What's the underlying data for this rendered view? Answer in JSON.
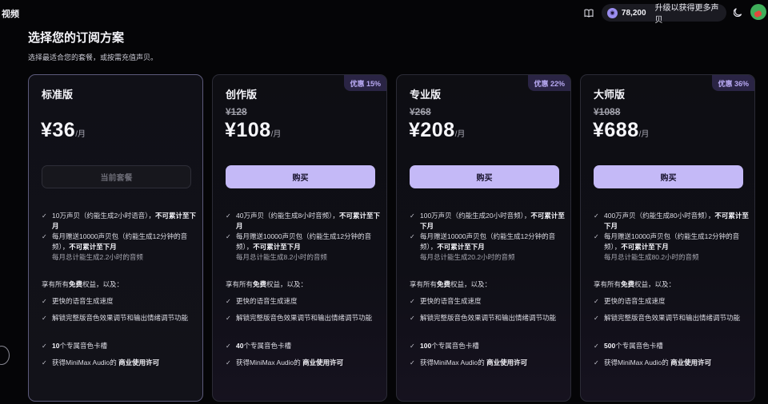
{
  "top": {
    "left_tab": "视频",
    "credits": "78,200",
    "upgrade": "升级以获得更多声贝"
  },
  "header": {
    "title": "选择您的订阅方案",
    "subtitle": "选择最适合您的套餐，或按需充值声贝。"
  },
  "common": {
    "per_month": "/月",
    "included_prefix": "享有所有",
    "included_bold": "免费",
    "included_suffix": "权益，以及：",
    "faster": "更快的语音生成速度",
    "unlock": "解锁完整版音色效果调节和输出情绪调节功能",
    "voice_slots_suffix": "个专属音色卡槽",
    "license_prefix": "获得MiniMax Audio的 ",
    "license_bold": "商业使用许可",
    "monthly_bonus_a": "每月赠送10000声贝包（约能生成12分钟的音频），",
    "no_rollover": "不可累计至下月"
  },
  "plans": [
    {
      "name": "标准版",
      "discount": "",
      "old_price": "",
      "price": "¥36",
      "button": "当前套餐",
      "is_current": true,
      "quota_text": "10万声贝（约能生成2小时语音），",
      "total_note": "每月总计能生成2.2小时的音频",
      "slots": "10"
    },
    {
      "name": "创作版",
      "discount": "优惠 15%",
      "old_price": "¥128",
      "price": "¥108",
      "button": "购买",
      "is_current": false,
      "quota_text": "40万声贝（约能生成8小时音频），",
      "total_note": "每月总计能生成8.2小时的音频",
      "slots": "40"
    },
    {
      "name": "专业版",
      "discount": "优惠 22%",
      "old_price": "¥268",
      "price": "¥208",
      "button": "购买",
      "is_current": false,
      "quota_text": "100万声贝（约能生成20小时音频），",
      "total_note": "每月总计能生成20.2小时的音频",
      "slots": "100"
    },
    {
      "name": "大师版",
      "discount": "优惠 36%",
      "old_price": "¥1088",
      "price": "¥688",
      "button": "购买",
      "is_current": false,
      "quota_text": "400万声贝（约能生成80小时音频），",
      "total_note": "每月总计能生成80.2小时的音频",
      "slots": "500"
    }
  ]
}
